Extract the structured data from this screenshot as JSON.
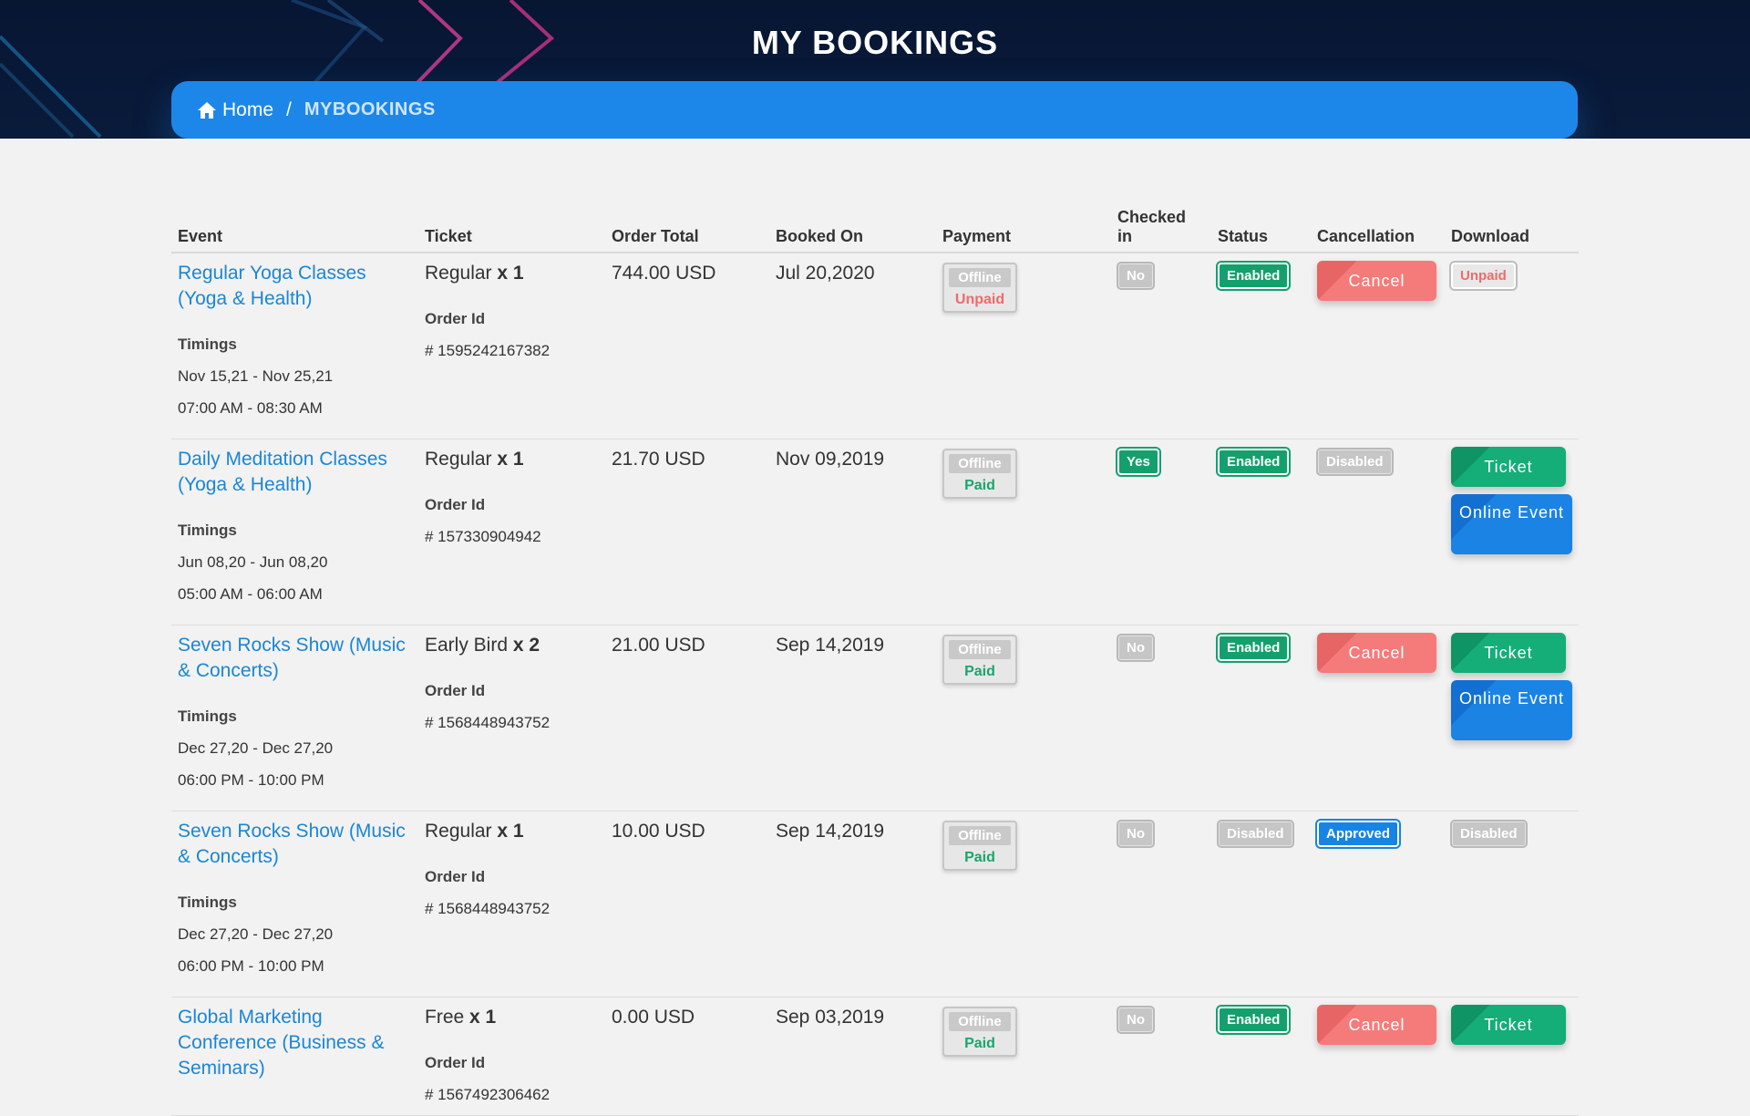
{
  "header": {
    "title": "MY BOOKINGS"
  },
  "breadcrumb": {
    "home_label": "Home",
    "separator": "/",
    "current": "MYBOOKINGS"
  },
  "table": {
    "columns": [
      "Event",
      "Ticket",
      "Order Total",
      "Booked On",
      "Payment",
      "Checked in",
      "Status",
      "Cancellation",
      "Download"
    ],
    "timings_label": "Timings",
    "order_id_label": "Order Id",
    "rows": [
      {
        "event": "Regular Yoga Classes (Yoga & Health)",
        "timing_dates": "Nov 15,21 - Nov 25,21",
        "timing_hours": "07:00 AM - 08:30 AM",
        "ticket_name": "Regular",
        "ticket_qty": "x 1",
        "order_id": "# 1595242167382",
        "order_total": "744.00 USD",
        "booked_on": "Jul 20,2020",
        "payment_method": "Offline",
        "payment_status": "Unpaid",
        "checked_in": "No",
        "status": "Enabled",
        "cancellation": "Cancel",
        "download": "Unpaid"
      },
      {
        "event": "Daily Meditation Classes (Yoga & Health)",
        "timing_dates": "Jun 08,20 - Jun 08,20",
        "timing_hours": "05:00 AM - 06:00 AM",
        "ticket_name": "Regular",
        "ticket_qty": "x 1",
        "order_id": "# 157330904942",
        "order_total": "21.70 USD",
        "booked_on": "Nov 09,2019",
        "payment_method": "Offline",
        "payment_status": "Paid",
        "checked_in": "Yes",
        "status": "Enabled",
        "cancellation": "Disabled",
        "download_ticket": "Ticket",
        "download_online": "Online Event"
      },
      {
        "event": "Seven Rocks Show (Music & Concerts)",
        "timing_dates": "Dec 27,20 - Dec 27,20",
        "timing_hours": "06:00 PM - 10:00 PM",
        "ticket_name": "Early Bird",
        "ticket_qty": "x 2",
        "order_id": "# 1568448943752",
        "order_total": "21.00 USD",
        "booked_on": "Sep 14,2019",
        "payment_method": "Offline",
        "payment_status": "Paid",
        "checked_in": "No",
        "status": "Enabled",
        "cancellation": "Cancel",
        "download_ticket": "Ticket",
        "download_online": "Online Event"
      },
      {
        "event": "Seven Rocks Show (Music & Concerts)",
        "timing_dates": "Dec 27,20 - Dec 27,20",
        "timing_hours": "06:00 PM - 10:00 PM",
        "ticket_name": "Regular",
        "ticket_qty": "x 1",
        "order_id": "# 1568448943752",
        "order_total": "10.00 USD",
        "booked_on": "Sep 14,2019",
        "payment_method": "Offline",
        "payment_status": "Paid",
        "checked_in": "No",
        "status": "Disabled",
        "cancellation": "Approved",
        "download": "Disabled"
      },
      {
        "event": "Global Marketing Conference (Business & Seminars)",
        "ticket_name": "Free",
        "ticket_qty": "x 1",
        "order_id": "# 1567492306462",
        "order_total": "0.00 USD",
        "booked_on": "Sep 03,2019",
        "payment_method": "Offline",
        "payment_status": "Paid",
        "checked_in": "No",
        "status": "Enabled",
        "cancellation": "Cancel",
        "download_ticket": "Ticket"
      }
    ]
  },
  "colors": {
    "header_bg": "#061633",
    "breadcrumb_bg": "#1d87e9",
    "link": "#1a86d6",
    "success": "#14a06d",
    "danger": "#f47b79",
    "primary": "#1b83e3"
  }
}
